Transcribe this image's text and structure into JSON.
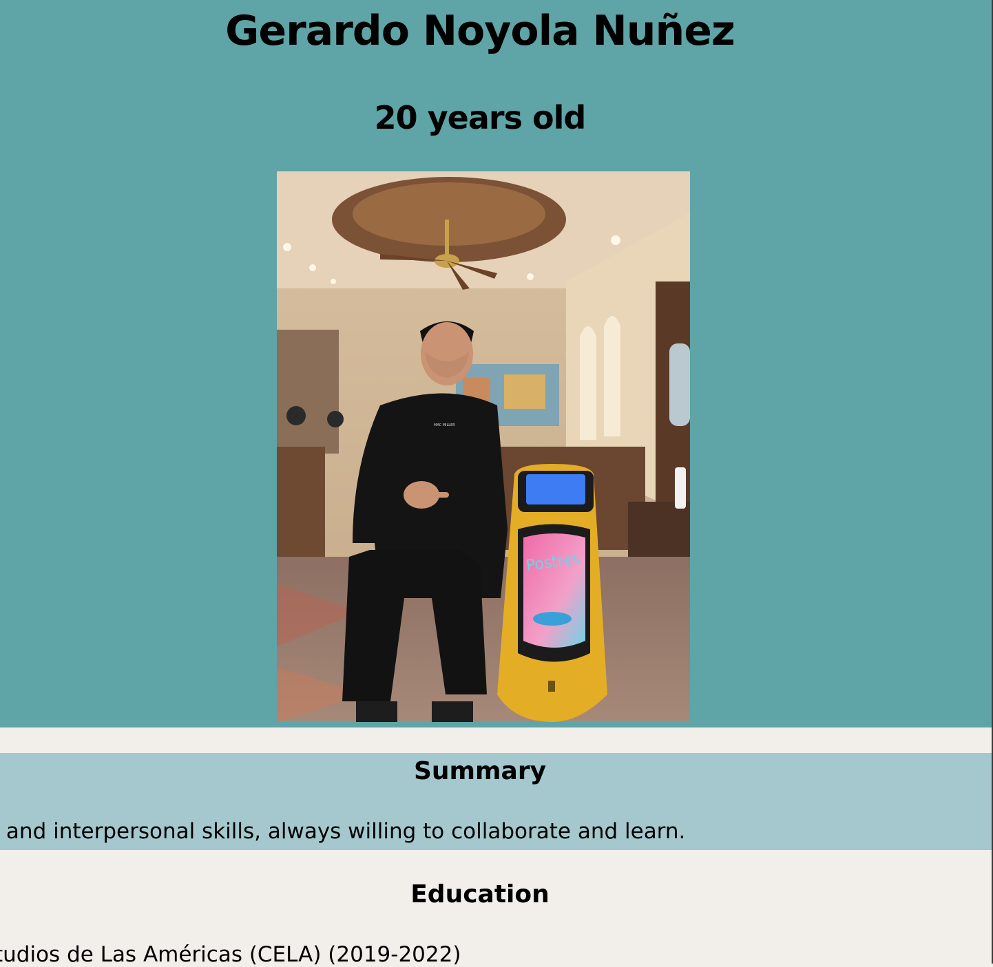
{
  "profile": {
    "name": "Gerardo Noyola Nuñez",
    "age": "20 years old",
    "photo": {
      "shirt_text": "MAC MILLER",
      "robot_screen_text": "Postres"
    }
  },
  "summary": {
    "title": "Summary",
    "text": "e and interpersonal skills, always willing to collaborate and learn."
  },
  "education": {
    "title": "Education",
    "text": "tudios de Las Américas (CELA) (2019-2022)"
  },
  "colors": {
    "hero_background": "#5fa4a6",
    "summary_background": "#a4c8ce",
    "page_background": "#f2efea"
  }
}
